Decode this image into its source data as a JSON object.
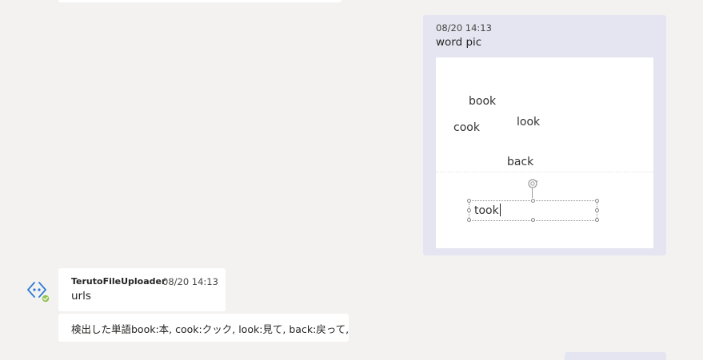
{
  "sent_message": {
    "timestamp": "08/20 14:13",
    "text": "word pic",
    "image": {
      "words": {
        "book": "book",
        "cook": "cook",
        "look": "look",
        "back": "back"
      },
      "textbox_value": "took"
    }
  },
  "received_message": {
    "avatar_icon": "bot-app-icon",
    "sender": "TerutoFileUploader",
    "timestamp": "08/20 14:13",
    "text": "urls",
    "followup_text": "検出した単語book:本, cook:クック, look:見て, back:戻って,"
  },
  "colors": {
    "background": "#f3f2f1",
    "sent_bubble": "#e5e5f1",
    "received_bubble": "#ffffff",
    "bot_icon_blue": "#2f7ad6",
    "status_green": "#92c353"
  }
}
